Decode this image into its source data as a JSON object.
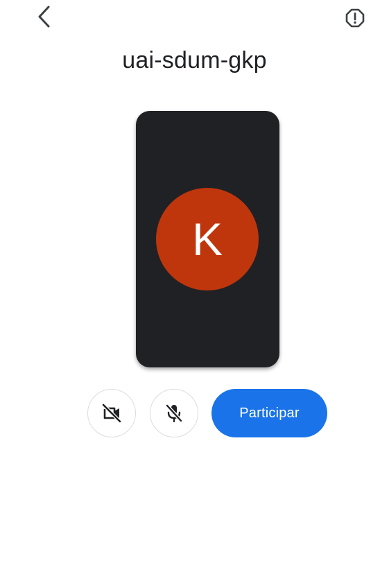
{
  "meeting": {
    "code": "uai-sdum-gkp"
  },
  "top_bar": {
    "back_icon": "chevron-left-icon",
    "report_icon": "report-alert-icon"
  },
  "preview": {
    "avatar_initial": "K",
    "avatar_color": "#C0360C",
    "background_color": "#202124"
  },
  "controls": {
    "camera_icon": "video-off-icon",
    "camera_state": "off",
    "mic_icon": "mic-off-icon",
    "mic_state": "off",
    "join_label": "Participar",
    "join_color": "#1A73E8"
  }
}
